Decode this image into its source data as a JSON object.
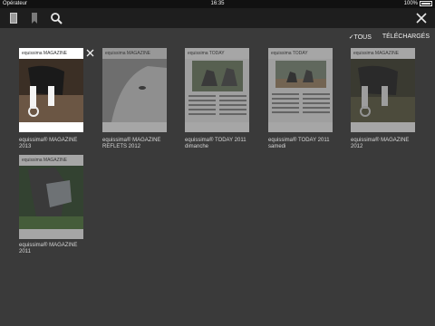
{
  "status": {
    "carrier": "Opérateur",
    "time": "16:35",
    "battery": "100%"
  },
  "toolbar": {
    "library_icon": "library-icon",
    "bookmark_icon": "bookmark-icon",
    "search_icon": "search-icon",
    "close_icon": "close-icon"
  },
  "filters": {
    "all": "✓TOUS",
    "downloaded": "TÉLÉCHARGÉS"
  },
  "magazines": [
    {
      "title_line1": "equissima® MAGAZINE",
      "title_line2": "2013",
      "cover_header": "equissima MAGAZINE",
      "downloaded": true
    },
    {
      "title_line1": "equissima® MAGAZINE",
      "title_line2": "REFLETS 2012",
      "cover_header": "equissima MAGAZINE",
      "downloaded": false
    },
    {
      "title_line1": "equissima® TODAY 2011",
      "title_line2": "dimanche",
      "cover_header": "equissima TODAY",
      "downloaded": false
    },
    {
      "title_line1": "equissima® TODAY 2011",
      "title_line2": "samedi",
      "cover_header": "equissima TODAY",
      "downloaded": false
    },
    {
      "title_line1": "equissima® MAGAZINE",
      "title_line2": "2012",
      "cover_header": "equissima MAGAZINE",
      "downloaded": false
    },
    {
      "title_line1": "equissima® MAGAZINE",
      "title_line2": "2011",
      "cover_header": "equissima MAGAZINE",
      "downloaded": false
    }
  ]
}
